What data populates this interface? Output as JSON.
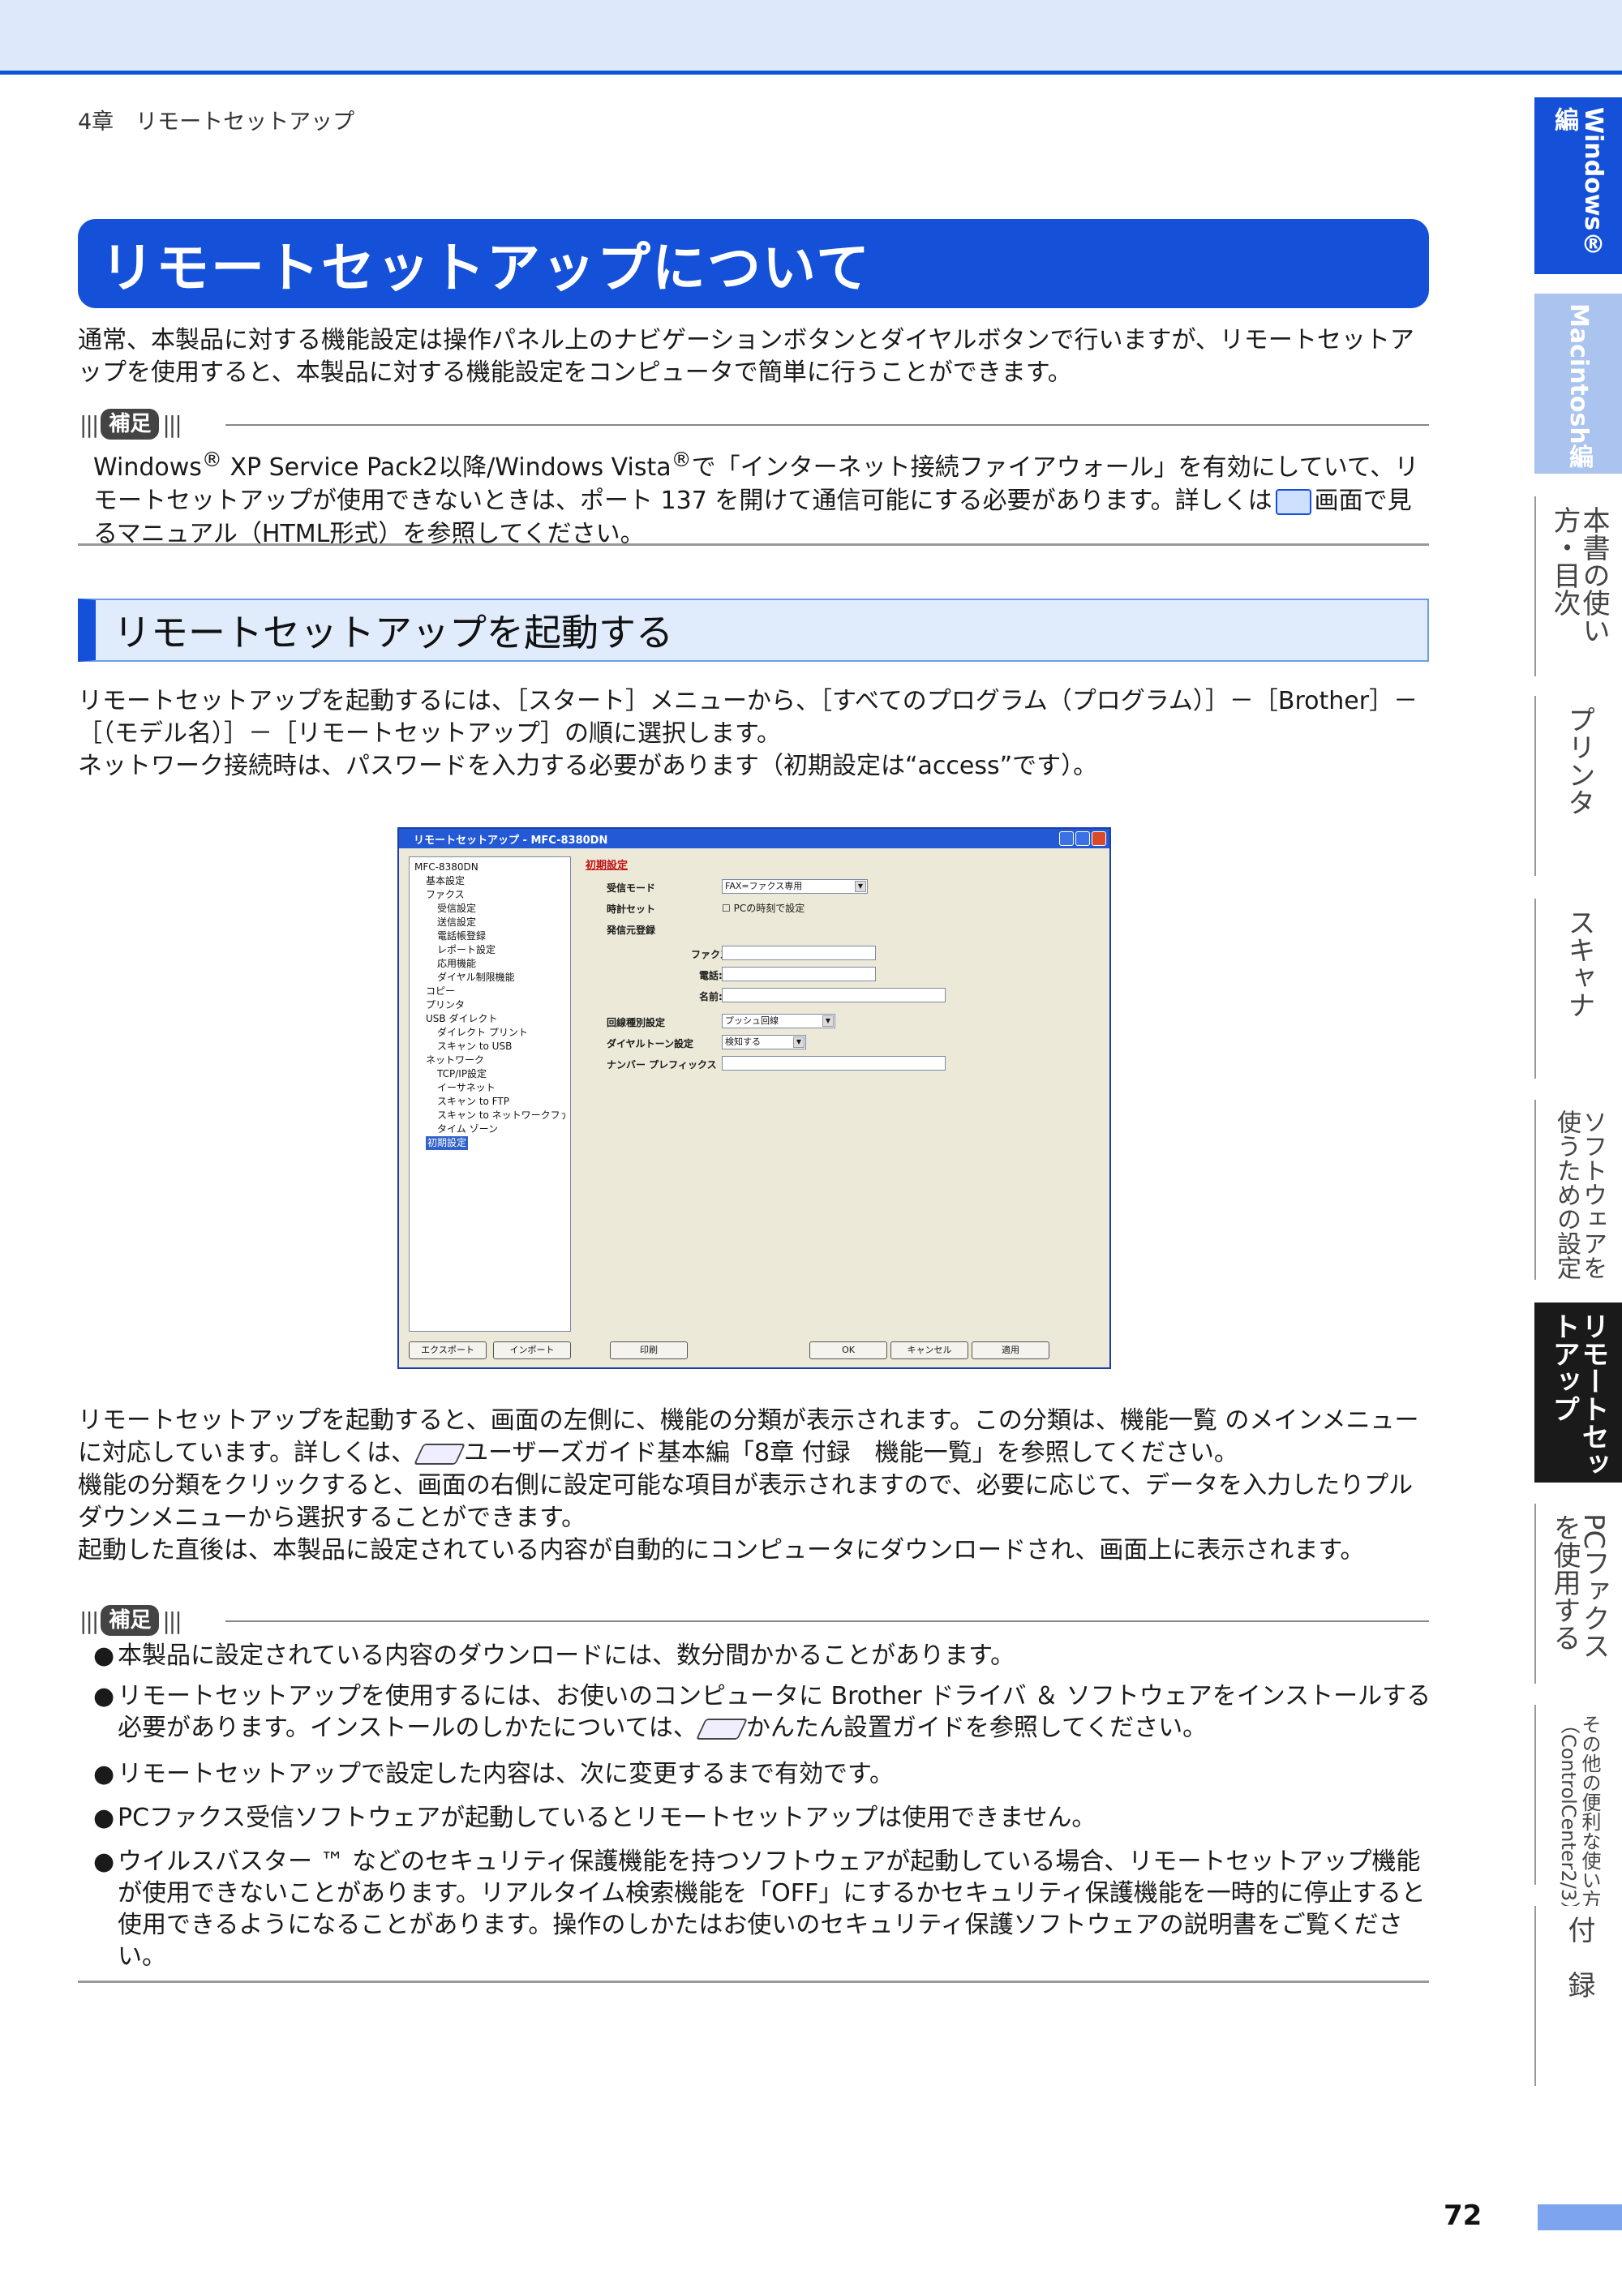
{
  "header": {
    "chapter": "4章　リモートセットアップ"
  },
  "section_title": "リモートセットアップについて",
  "intro": "通常、本製品に対する機能設定は操作パネル上のナビゲーションボタンとダイヤルボタンで行いますが、リモートセットアップを使用すると、本製品に対する機能設定をコンピュータで簡単に行うことができます。",
  "note_label": "補足",
  "note1": {
    "text_a": "Windows",
    "reg": "®",
    "text_b": " XP Service Pack2以降/Windows Vista",
    "text_c": "で「インターネット接続ファイアウォール」を有効にしていて、リモートセットアップが使用できないときは、ポート 137 を開けて通信可能にする必要があります。詳しくは",
    "text_d": "画面で見るマニュアル（HTML形式）を参照してください。"
  },
  "subsection_title": "リモートセットアップを起動する",
  "start_text": {
    "line1": "リモートセットアップを起動するには、［スタート］メニューから、［すべてのプログラム（プログラム）］－［Brother］－［（モデル名）］－［リモートセットアップ］の順に選択します。",
    "line2": "ネットワーク接続時は、パスワードを入力する必要があります（初期設定は“access”です）。"
  },
  "window": {
    "title": "リモートセットアップ - MFC-8380DN",
    "tree": [
      "MFC-8380DN",
      "基本設定",
      "ファクス",
      "受信設定",
      "送信設定",
      "電話帳登録",
      "レポート設定",
      "応用機能",
      "ダイヤル制限機能",
      "コピー",
      "プリンタ",
      "USB ダイレクト",
      "ダイレクト プリント",
      "スキャン to USB",
      "ネットワーク",
      "TCP/IP設定",
      "イーサネット",
      "スキャン to FTP",
      "スキャン to ネットワークファイル",
      "タイム ゾーン",
      "初期設定"
    ],
    "form_title": "初期設定",
    "labels": {
      "receive_mode": "受信モード",
      "clock": "時計セット",
      "sender": "発信元登録",
      "fax": "ファクス:",
      "phone": "電話:",
      "name": "名前:",
      "line_type": "回線種別設定",
      "dial_tone": "ダイヤルトーン設定",
      "prefix": "ナンバー プレフィックス"
    },
    "values": {
      "receive_mode": "FAX=ファクス専用",
      "clock_check": "PCの時刻で設定",
      "line_type": "プッシュ回線",
      "dial_tone": "検知する"
    },
    "buttons": {
      "export": "エクスポート",
      "import": "インポート",
      "print": "印刷",
      "ok": "OK",
      "cancel": "キャンセル",
      "apply": "適用"
    }
  },
  "after_text": {
    "p1a": "リモートセットアップを起動すると、画面の左側に、機能の分類が表示されます。この分類は、機能一覧 のメインメニューに対応しています。詳しくは、",
    "p1b": "ユーザーズガイド基本編「8章 付録　機能一覧」を参照してください。",
    "p2": "機能の分類をクリックすると、画面の右側に設定可能な項目が表示されますので、必要に応じて、データを入力したりプルダウンメニューから選択することができます。",
    "p3": "起動した直後は、本製品に設定されている内容が自動的にコンピュータにダウンロードされ、画面上に表示されます。"
  },
  "bullets": {
    "b1": "本製品に設定されている内容のダウンロードには、数分間かかることがあります。",
    "b2a": "リモートセットアップを使用するには、お使いのコンピュータに Brother ドライバ ＆ ソフトウェアをインストールする必要があります。インストールのしかたについては、",
    "b2b": "かんたん設置ガイドを参照してください。",
    "b3": "リモートセットアップで設定した内容は、次に変更するまで有効です。",
    "b4": "PCファクス受信ソフトウェアが起動しているとリモートセットアップは使用できません。",
    "b5": "ウイルスバスター ™ などのセキュリティ保護機能を持つソフトウェアが起動している場合、リモートセットアップ機能が使用できないことがあります。リアルタイム検索機能を「OFF」にするかセキュリティ保護機能を一時的に停止すると使用できるようになることがあります。操作のしかたはお使いのセキュリティ保護ソフトウェアの説明書をご覧ください。",
    "dot": "●"
  },
  "side_tabs": {
    "windows": "Windows®編",
    "mac": "Macintosh編",
    "t1": "本書の使い方・目次",
    "t2": "プリンタ",
    "t3": "スキャナ",
    "t4": "ソフトウェアを使うための設定",
    "t5": "リモートセットアップ",
    "t6": "PCファクスを使用する",
    "t7": "その他の便利な使い方（ControlCenter2/3）",
    "t8": "付　録"
  },
  "page_number": "72"
}
